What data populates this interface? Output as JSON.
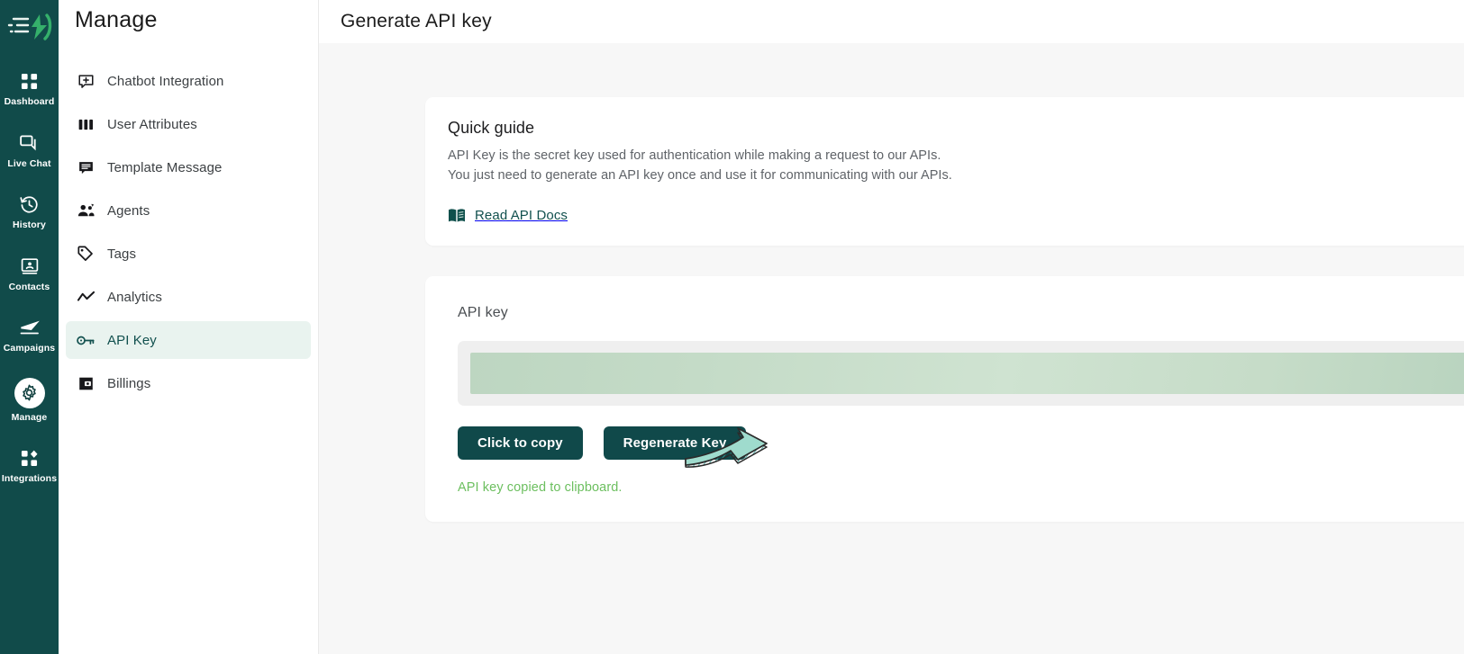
{
  "rail": {
    "logo_icon": "lightning-logo-icon",
    "items": [
      {
        "label": "Dashboard",
        "icon": "dashboard-grid-icon",
        "active": false
      },
      {
        "label": "Live Chat",
        "icon": "chat-bubbles-icon",
        "active": false
      },
      {
        "label": "History",
        "icon": "clock-rewind-icon",
        "active": false
      },
      {
        "label": "Contacts",
        "icon": "contact-card-icon",
        "active": false
      },
      {
        "label": "Campaigns",
        "icon": "paper-plane-icon",
        "active": false
      },
      {
        "label": "Manage",
        "icon": "gear-icon",
        "active": true
      },
      {
        "label": "Integrations",
        "icon": "integrations-icon",
        "active": false
      }
    ]
  },
  "sidebar": {
    "title": "Manage",
    "items": [
      {
        "label": "Chatbot Integration",
        "icon": "chatbot-plus-icon",
        "active": false
      },
      {
        "label": "User Attributes",
        "icon": "columns-icon",
        "active": false
      },
      {
        "label": "Template Message",
        "icon": "message-lines-icon",
        "active": false
      },
      {
        "label": "Agents",
        "icon": "agents-people-icon",
        "active": false
      },
      {
        "label": "Tags",
        "icon": "tag-icon",
        "active": false
      },
      {
        "label": "Analytics",
        "icon": "trend-line-icon",
        "active": false
      },
      {
        "label": "API Key",
        "icon": "key-icon",
        "active": true
      },
      {
        "label": "Billings",
        "icon": "wallet-icon",
        "active": false
      }
    ]
  },
  "header": {
    "title": "Generate API key"
  },
  "quick_guide": {
    "title": "Quick guide",
    "line1": "API Key is the secret key used for authentication while making a request to our APIs.",
    "line2": "You just need to generate an API key once and use it for communicating with our APIs.",
    "docs_link": "Read API Docs",
    "docs_icon": "open-book-icon"
  },
  "api_key_section": {
    "label": "API key",
    "value_masked": "",
    "copy_button": "Click to copy",
    "regenerate_button": "Regenerate Key",
    "toast": "API key copied to clipboard."
  },
  "annotation": {
    "arrow_icon": "curved-right-arrow-icon"
  },
  "colors": {
    "rail_bg": "#114b4a",
    "button_bg": "#10494a",
    "active_item_bg": "#e9f3ef",
    "active_item_text": "#11504e",
    "toast_green": "#6cbf5f",
    "arrow_fill": "#9fdbcd",
    "page_bg": "#f7f7f7"
  }
}
